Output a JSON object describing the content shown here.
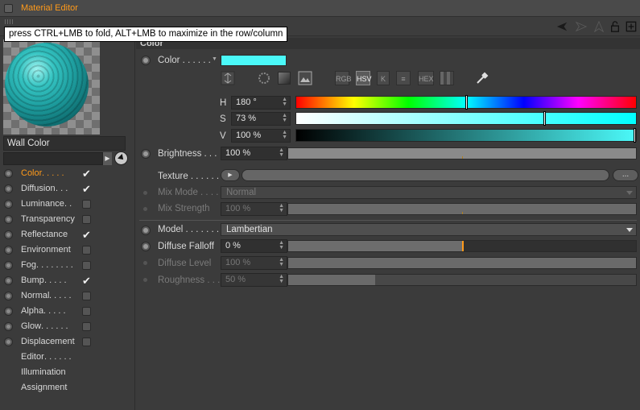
{
  "window": {
    "title": "Material Editor"
  },
  "tooltip": "press CTRL+LMB to fold, ALT+LMB to maximize in the row/column",
  "toolbar": {
    "icons": [
      "arrow-left-icon",
      "arrow-right-icon",
      "up-arrow-icon",
      "lock-icon",
      "new-window-icon"
    ]
  },
  "left": {
    "material_name": "Wall Color",
    "channels": [
      {
        "label": "Color",
        "dots": " . . . . .",
        "checked": true,
        "active": true,
        "radio": true
      },
      {
        "label": "Diffusion",
        "dots": " . . .",
        "checked": true,
        "active": false,
        "radio": true
      },
      {
        "label": "Luminance",
        "dots": " . .",
        "checked": false,
        "active": false,
        "radio": true
      },
      {
        "label": "Transparency",
        "dots": "",
        "checked": false,
        "active": false,
        "radio": true
      },
      {
        "label": "Reflectance",
        "dots": "",
        "checked": true,
        "active": false,
        "radio": true
      },
      {
        "label": "Environment",
        "dots": "",
        "checked": false,
        "active": false,
        "radio": true
      },
      {
        "label": "Fog",
        "dots": " . . . . . . . .",
        "checked": false,
        "active": false,
        "radio": true
      },
      {
        "label": "Bump",
        "dots": " . . . . .",
        "checked": true,
        "active": false,
        "radio": true
      },
      {
        "label": "Normal",
        "dots": " . . . . .",
        "checked": false,
        "active": false,
        "radio": true
      },
      {
        "label": "Alpha",
        "dots": " . . . . .",
        "checked": false,
        "active": false,
        "radio": true
      },
      {
        "label": "Glow",
        "dots": " . . . . . .",
        "checked": false,
        "active": false,
        "radio": true
      },
      {
        "label": "Displacement",
        "dots": "",
        "checked": false,
        "active": false,
        "radio": true
      },
      {
        "label": "Editor",
        "dots": " . . . . . .",
        "checked": null,
        "active": false,
        "radio": false
      },
      {
        "label": "Illumination",
        "dots": "",
        "checked": null,
        "active": false,
        "radio": false
      },
      {
        "label": "Assignment",
        "dots": "",
        "checked": null,
        "active": false,
        "radio": false
      }
    ]
  },
  "main": {
    "section_title": "Color",
    "color_label": "Color . . . . . .",
    "color_swatch": "#4bf9f9",
    "color_modes": [
      "RGB",
      "HSV",
      "K",
      "HEX"
    ],
    "selected_mode": "HSV",
    "h": {
      "label": "H",
      "value": "180 °",
      "fraction": 0.5
    },
    "s": {
      "label": "S",
      "value": "73 %",
      "fraction": 0.73
    },
    "v": {
      "label": "V",
      "value": "100 %",
      "fraction": 1.0
    },
    "brightness": {
      "label": "Brightness . . .",
      "value": "100 %",
      "fraction": 1.0
    },
    "texture": {
      "label": "Texture . . . . . .",
      "more": "..."
    },
    "mix_mode": {
      "label": "Mix Mode . . . .",
      "value": "Normal"
    },
    "mix_strength": {
      "label": "Mix Strength",
      "value": "100 %",
      "fraction": 1.0
    },
    "model": {
      "label": "Model . . . . . . .",
      "value": "Lambertian"
    },
    "diffuse_falloff": {
      "label": "Diffuse Falloff",
      "value": "0 %",
      "fraction": 0.5
    },
    "diffuse_level": {
      "label": "Diffuse Level",
      "value": "100 %",
      "fraction": 1.0
    },
    "roughness": {
      "label": "Roughness . . .",
      "value": "50 %",
      "fraction": 0.25
    }
  },
  "colors": {
    "accent": "#ff9a1a",
    "swatch": "#4bf9f9"
  }
}
